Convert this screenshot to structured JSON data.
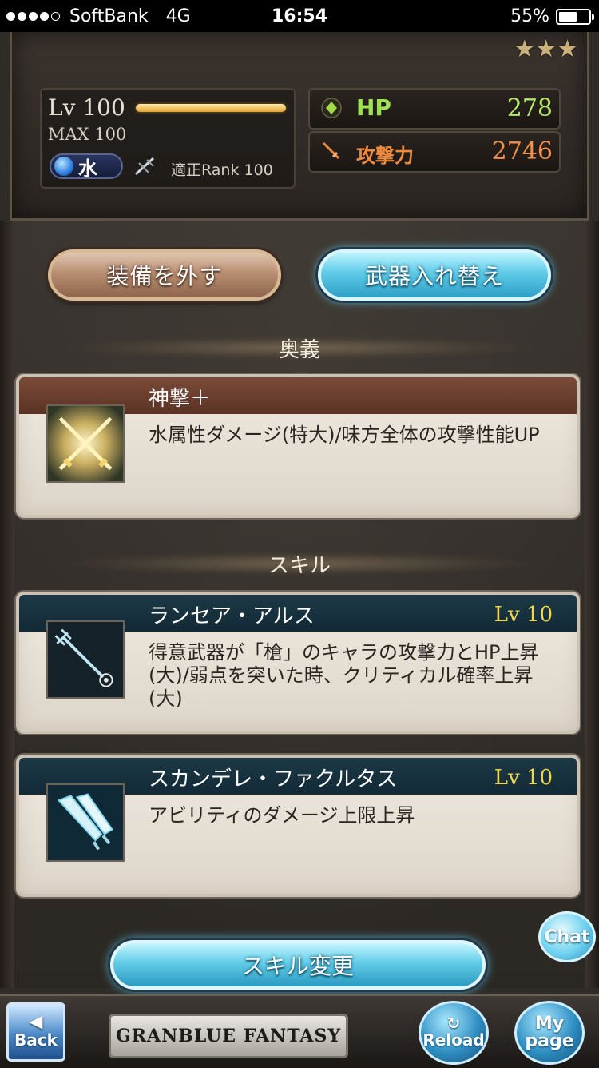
{
  "status_bar": {
    "carrier": "SoftBank",
    "network": "4G",
    "time": "16:54",
    "battery": "55%",
    "signal_bars": 4
  },
  "weapon": {
    "rarity_stars": "★★★",
    "level_label": "Lv 100",
    "max_label": "MAX 100",
    "element": "水",
    "rank_label": "適正Rank 100",
    "hp_label": "HP",
    "hp_value": "278",
    "atk_label": "攻撃力",
    "atk_value": "2746"
  },
  "buttons": {
    "unequip": "装備を外す",
    "swap": "武器入れ替え",
    "skill_change": "スキル変更"
  },
  "sections": {
    "ougi": "奥義",
    "skill": "スキル"
  },
  "ougi_card": {
    "title": "神撃＋",
    "description": "水属性ダメージ(特大)/味方全体の攻撃性能UP"
  },
  "skills": [
    {
      "title": "ランセア・アルス",
      "level": "Lv 10",
      "description": "得意武器が「槍」のキャラの攻撃力とHP上昇(大)/弱点を突いた時、クリティカル確率上昇(大)"
    },
    {
      "title": "スカンデレ・ファクルタス",
      "level": "Lv 10",
      "description": "アビリティのダメージ上限上昇"
    }
  ],
  "nav": {
    "chat": "Chat",
    "back": "Back",
    "logo": "GRANBLUE FANTASY",
    "reload": "Reload",
    "mypage_1": "My",
    "mypage_2": "page"
  },
  "colors": {
    "hp": "#9be352",
    "atk": "#f08a3c",
    "skill_level": "#f3d84a",
    "accent_blue": "#5fcbe8",
    "accent_brown": "#b98f73"
  }
}
